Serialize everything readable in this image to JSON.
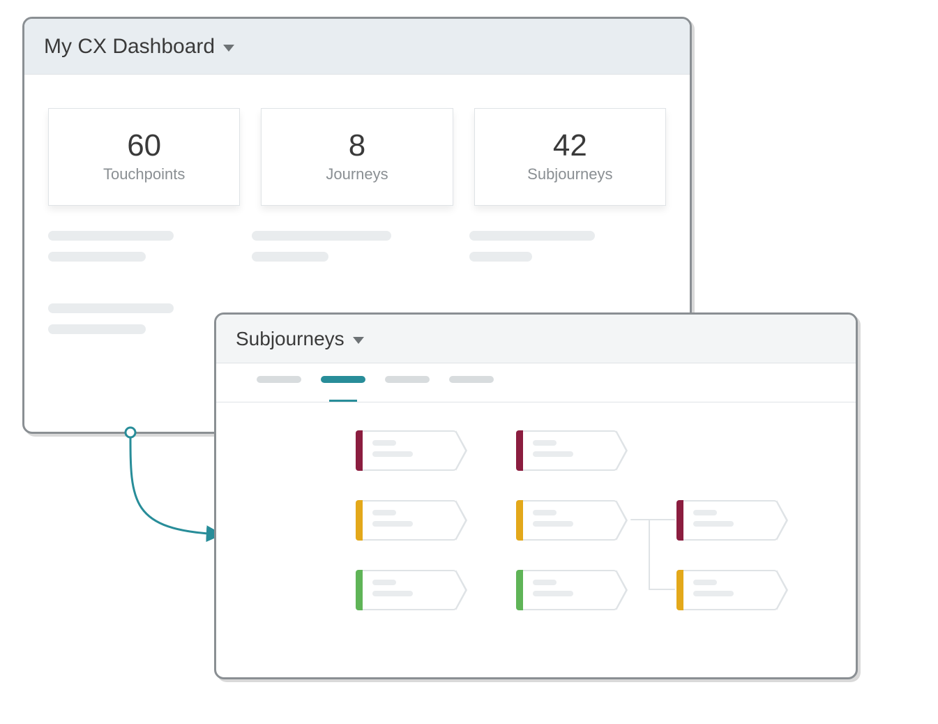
{
  "dashboard": {
    "title": "My CX Dashboard",
    "stats": [
      {
        "value": "60",
        "label": "Touchpoints"
      },
      {
        "value": "8",
        "label": "Journeys"
      },
      {
        "value": "42",
        "label": "Subjourneys"
      }
    ]
  },
  "subpanel": {
    "title": "Subjourneys",
    "tabs": [
      {
        "active": false
      },
      {
        "active": true
      },
      {
        "active": false
      },
      {
        "active": false
      }
    ],
    "nodes": [
      {
        "id": "a1",
        "col": 0,
        "row": 0,
        "status": "maroon"
      },
      {
        "id": "a2",
        "col": 0,
        "row": 1,
        "status": "amber"
      },
      {
        "id": "a3",
        "col": 0,
        "row": 2,
        "status": "green"
      },
      {
        "id": "b1",
        "col": 1,
        "row": 0,
        "status": "maroon"
      },
      {
        "id": "b2",
        "col": 1,
        "row": 1,
        "status": "amber"
      },
      {
        "id": "b3",
        "col": 1,
        "row": 2,
        "status": "green"
      },
      {
        "id": "c1",
        "col": 2,
        "row": 1,
        "status": "maroon"
      },
      {
        "id": "c2",
        "col": 2,
        "row": 2,
        "status": "amber"
      }
    ],
    "colors": {
      "maroon": "#8b1d3f",
      "amber": "#e3a81a",
      "green": "#5fb457",
      "teal": "#288d99"
    }
  }
}
